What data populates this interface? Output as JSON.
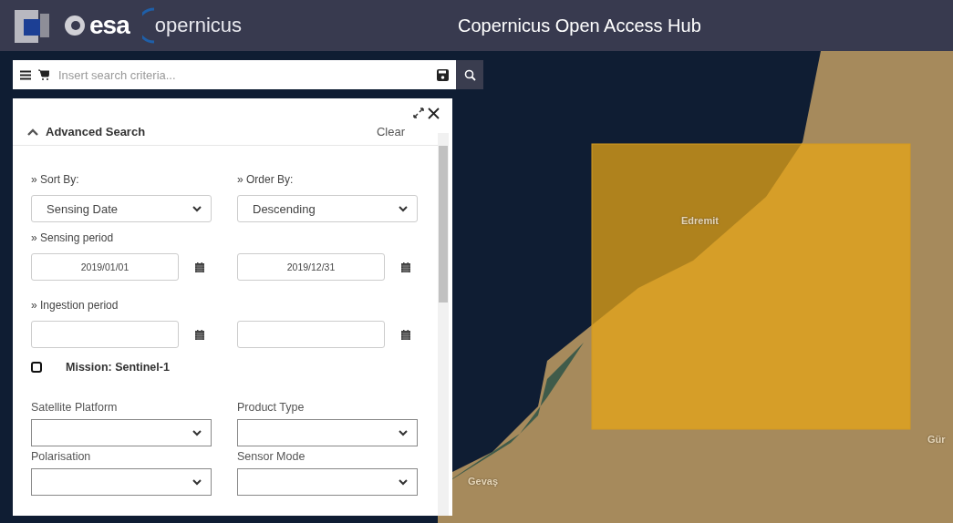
{
  "header": {
    "logo_esa": "esa",
    "logo_copernicus": "opernicus",
    "title": "Copernicus Open Access Hub"
  },
  "search": {
    "placeholder": "Insert search criteria..."
  },
  "panel": {
    "title": "Advanced Search",
    "expanded": true,
    "clear": "Clear",
    "sort_by": {
      "label": "» Sort By:",
      "value": "Sensing Date"
    },
    "order_by": {
      "label": "» Order By:",
      "value": "Descending"
    },
    "sensing_period": {
      "label": "» Sensing period",
      "from": "2019/01/01",
      "to": "2019/12/31"
    },
    "ingestion_period": {
      "label": "» Ingestion period"
    },
    "mission": {
      "label": "Mission: Sentinel-1",
      "checked": false
    },
    "selects": [
      {
        "label": "Satellite Platform"
      },
      {
        "label": "Product Type"
      },
      {
        "label": "Polarisation"
      },
      {
        "label": "Sensor Mode"
      }
    ]
  },
  "map_labels": [
    "Edremit",
    "Gevaş",
    "Gür"
  ]
}
